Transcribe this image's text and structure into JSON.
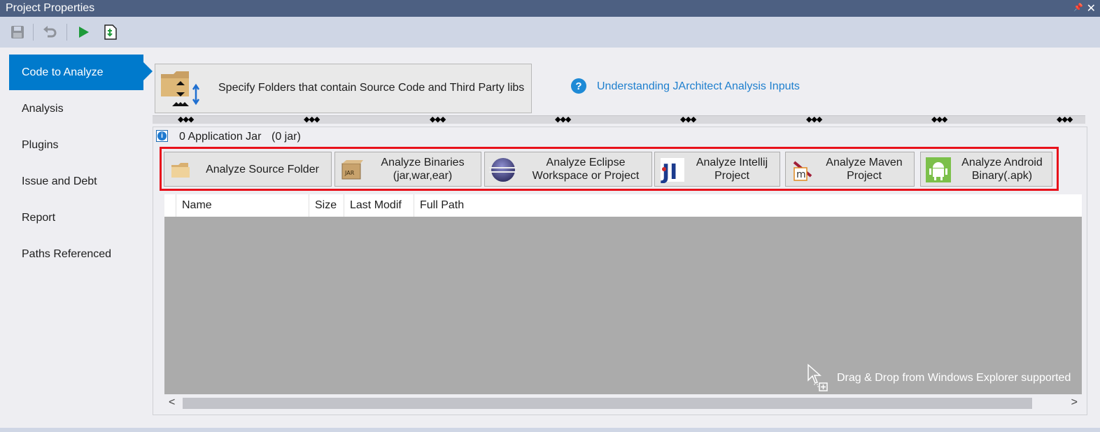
{
  "window": {
    "title": "Project Properties",
    "pin_glyph": "📌",
    "close_glyph": "✕"
  },
  "toolbar": {
    "buttons": [
      {
        "name": "save",
        "icon": "floppy-disk-icon"
      },
      {
        "name": "undo",
        "icon": "undo-icon"
      },
      {
        "name": "run",
        "icon": "play-icon"
      },
      {
        "name": "export",
        "icon": "export-document-icon"
      }
    ]
  },
  "sidebar": {
    "items": [
      {
        "label": "Code to Analyze",
        "active": true
      },
      {
        "label": "Analysis"
      },
      {
        "label": "Plugins"
      },
      {
        "label": "Issue and Debt"
      },
      {
        "label": "Report"
      },
      {
        "label": "Paths Referenced"
      }
    ]
  },
  "main": {
    "header_button": "Specify Folders that contain Source Code and Third Party libs",
    "help_link": "Understanding JArchitect Analysis Inputs",
    "help_glyph": "?",
    "info_glyph": "i",
    "app_jar_label": "0 Application Jar",
    "app_jar_count": "(0 jar)",
    "grip_glyph": "◆◆◆",
    "analyze_buttons": [
      {
        "label": "Analyze Source Folder",
        "icon": "folder-icon"
      },
      {
        "label": "Analyze Binaries\n(jar,war,ear)",
        "icon": "jar-box-icon"
      },
      {
        "label": "Analyze Eclipse\nWorkspace or Project",
        "icon": "eclipse-icon"
      },
      {
        "label": "Analyze Intellij\nProject",
        "icon": "intellij-icon"
      },
      {
        "label": "Analyze Maven\nProject",
        "icon": "maven-icon"
      },
      {
        "label": "Analyze Android\nBinary(.apk)",
        "icon": "android-icon"
      }
    ],
    "grid": {
      "columns": [
        "Name",
        "Size",
        "Last Modif",
        "Full Path"
      ],
      "drag_drop_hint": "Drag & Drop from Windows Explorer supported"
    },
    "scroll": {
      "left": "<",
      "right": ">"
    }
  }
}
